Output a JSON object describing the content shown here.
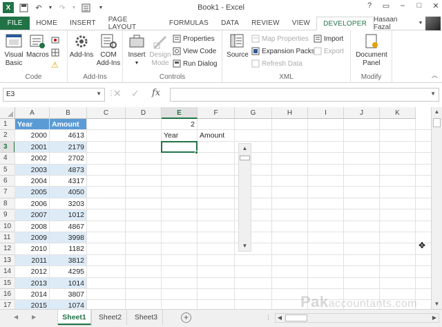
{
  "window": {
    "title": "Book1 - Excel",
    "controls": [
      "?",
      "▭",
      "–",
      "□",
      "✕"
    ]
  },
  "ribbon_tabs": [
    "FILE",
    "HOME",
    "INSERT",
    "PAGE LAYOUT",
    "FORMULAS",
    "DATA",
    "REVIEW",
    "VIEW",
    "DEVELOPER"
  ],
  "active_tab": "DEVELOPER",
  "user": {
    "name": "Hasaan Fazal"
  },
  "ribbon": {
    "code": {
      "label": "Code",
      "visual_basic": "Visual\nBasic",
      "macros": "Macros"
    },
    "addins": {
      "label": "Add-Ins",
      "addins": "Add-Ins",
      "com_addins": "COM\nAdd-Ins"
    },
    "controls": {
      "label": "Controls",
      "insert": "Insert",
      "design_mode": "Design\nMode",
      "properties": "Properties",
      "view_code": "View Code",
      "run_dialog": "Run Dialog"
    },
    "xml": {
      "label": "XML",
      "source": "Source",
      "map_properties": "Map Properties",
      "expansion_packs": "Expansion Packs",
      "refresh_data": "Refresh Data",
      "import": "Import",
      "export": "Export"
    },
    "modify": {
      "label": "Modify",
      "document_panel": "Document\nPanel"
    }
  },
  "formula_bar": {
    "name_box": "E3",
    "fx": "fx",
    "formula": ""
  },
  "grid": {
    "columns": [
      "A",
      "B",
      "C",
      "D",
      "E",
      "F",
      "G",
      "H",
      "I",
      "J",
      "K"
    ],
    "rows": [
      "1",
      "2",
      "3",
      "4",
      "5",
      "6",
      "7",
      "8",
      "9",
      "10",
      "11",
      "12",
      "13",
      "14",
      "15",
      "16",
      "17"
    ],
    "selected_column": "E",
    "selected_row": "3",
    "table_headers": [
      "Year",
      "Amount"
    ],
    "table_rows": [
      [
        "2000",
        "4613"
      ],
      [
        "2001",
        "2179"
      ],
      [
        "2002",
        "2702"
      ],
      [
        "2003",
        "4873"
      ],
      [
        "2004",
        "4317"
      ],
      [
        "2005",
        "4050"
      ],
      [
        "2006",
        "3203"
      ],
      [
        "2007",
        "1012"
      ],
      [
        "2008",
        "4867"
      ],
      [
        "2009",
        "3998"
      ],
      [
        "2010",
        "1182"
      ],
      [
        "2011",
        "3812"
      ],
      [
        "2012",
        "4295"
      ],
      [
        "2013",
        "1014"
      ],
      [
        "2014",
        "3807"
      ],
      [
        "2015",
        "1074"
      ]
    ],
    "e1_value": "2",
    "e2_label": "Year",
    "f2_label": "Amount"
  },
  "sheets": [
    "Sheet1",
    "Sheet2",
    "Sheet3"
  ],
  "active_sheet": "Sheet1",
  "add_sheet_label": "+",
  "watermark": {
    "brand": "Pak",
    "suffix": "accountants.com"
  },
  "colors": {
    "excel_green": "#217346",
    "table_header": "#5b9bd5",
    "table_band": "#ddebf7"
  }
}
